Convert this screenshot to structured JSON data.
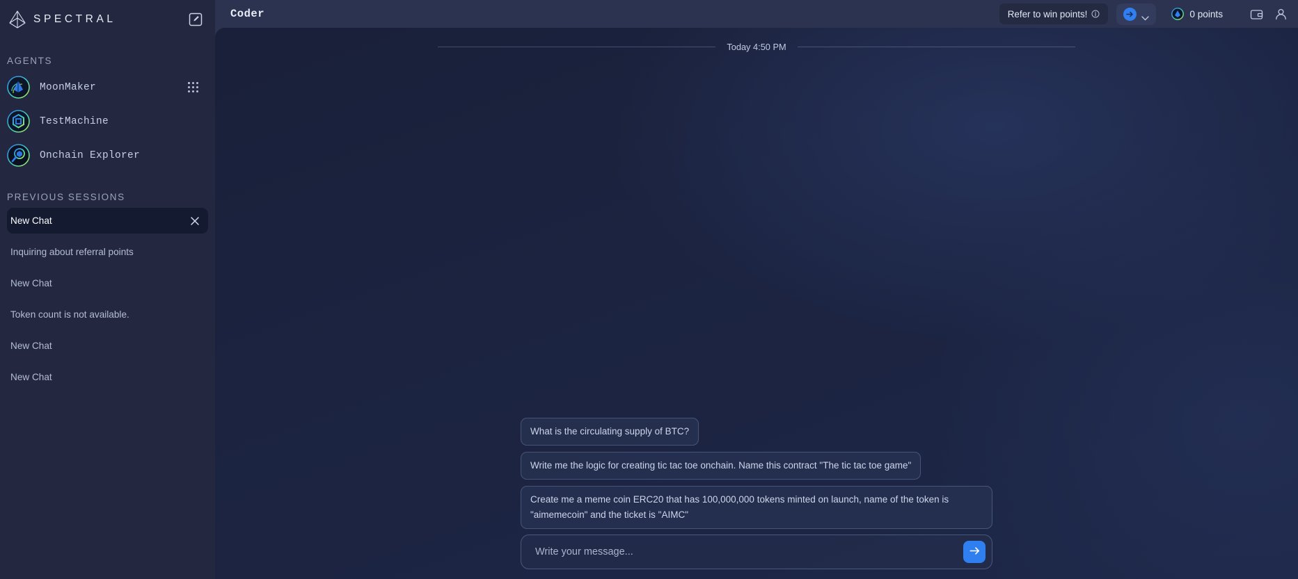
{
  "brand": {
    "name": "SPECTRAL",
    "logo_icon": "spectral-prism-logo",
    "compose_icon": "compose-edit-icon"
  },
  "sidebar": {
    "agents_label": "AGENTS",
    "agents": [
      {
        "name": "MoonMaker",
        "avatar_icon": "moonmaker-avatar",
        "menu_icon": "grid-dots-icon"
      },
      {
        "name": "TestMachine",
        "avatar_icon": "testmachine-avatar"
      },
      {
        "name": "Onchain Explorer",
        "avatar_icon": "onchain-explorer-avatar"
      }
    ],
    "sessions_label": "PREVIOUS SESSIONS",
    "sessions": [
      {
        "title": "New Chat",
        "active": true,
        "close_icon": "close-x-icon"
      },
      {
        "title": "Inquiring about referral points",
        "active": false
      },
      {
        "title": "New Chat",
        "active": false
      },
      {
        "title": "Token count is not available.",
        "active": false
      },
      {
        "title": "New Chat",
        "active": false
      },
      {
        "title": "New Chat",
        "active": false
      }
    ]
  },
  "header": {
    "title": "Coder",
    "refer_label": "Refer to win points!",
    "refer_info_icon": "info-circle-icon",
    "network_token_icon": "ethereum-token-icon",
    "network_chevron_icon": "chevron-down-icon",
    "points_icon": "spectral-points-icon",
    "points_label": "0 points",
    "wallet_icon": "wallet-icon",
    "profile_icon": "user-profile-icon"
  },
  "chat": {
    "date_divider": "Today 4:50 PM",
    "messages": [
      {
        "text": "What is the circulating supply of BTC?",
        "sender": "user"
      },
      {
        "text": "Write me the logic for creating tic tac toe onchain. Name this contract \"The tic tac toe game\"",
        "sender": "user"
      },
      {
        "text": "Create me a meme coin ERC20 that has 100,000,000 tokens minted on launch, name of the token is \"aimemecoin\" and the ticket is \"AIMC\"",
        "sender": "user"
      }
    ]
  },
  "composer": {
    "placeholder": "Write your message...",
    "value": "",
    "send_icon": "arrow-right-icon"
  },
  "colors": {
    "accent_blue": "#2f7ff0",
    "sidebar_bg": "#232840",
    "panel_bg": "#1b2340",
    "active_session": "#141a30"
  }
}
